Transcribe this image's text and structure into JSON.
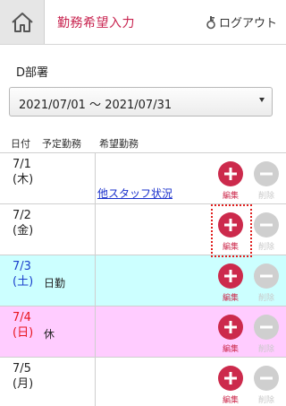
{
  "header": {
    "title": "勤務希望入力",
    "logout_label": "ログアウト",
    "home_icon": "home-icon",
    "logout_icon": "key-icon"
  },
  "department": {
    "label": "D部署"
  },
  "period": {
    "selected": "2021/07/01 〜 2021/07/31"
  },
  "columns": {
    "date": "日付",
    "planned": "予定勤務",
    "requested": "希望勤務"
  },
  "rows": [
    {
      "date": "7/1",
      "dow": "(木)",
      "planned": "",
      "link": "他スタッフ状況"
    },
    {
      "date": "7/2",
      "dow": "(金)",
      "planned": "",
      "link": ""
    },
    {
      "date": "7/3",
      "dow": "(土)",
      "planned": "日勤",
      "link": ""
    },
    {
      "date": "7/4",
      "dow": "(日)",
      "planned": "休",
      "link": ""
    },
    {
      "date": "7/5",
      "dow": "(月)",
      "planned": "",
      "link": ""
    }
  ],
  "buttons": {
    "edit_label": "編集",
    "delete_label": "削除"
  },
  "colors": {
    "brand": "#c8234f",
    "saturday_bg": "#ccffff",
    "sunday_bg": "#ffccff",
    "highlight": "#e0201f"
  }
}
